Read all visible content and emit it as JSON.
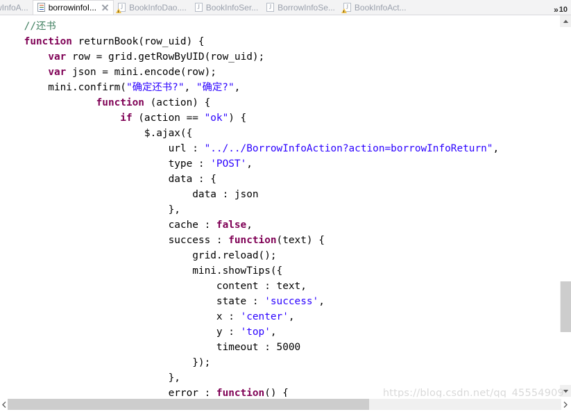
{
  "tabbar": {
    "tabs": [
      {
        "label": "wInfoA...",
        "icon": "javascript-file-icon",
        "state": "partial",
        "active": false,
        "closable": false
      },
      {
        "label": "borrowinfoI...",
        "icon": "javascript-file-icon",
        "state": "normal",
        "active": true,
        "closable": true
      },
      {
        "label": "BookInfoDao....",
        "icon": "java-file-warning-icon",
        "state": "normal",
        "active": false,
        "closable": false
      },
      {
        "label": "BookInfoSer...",
        "icon": "java-file-icon",
        "state": "normal",
        "active": false,
        "closable": false
      },
      {
        "label": "BorrowInfoSe...",
        "icon": "java-file-icon",
        "state": "normal",
        "active": false,
        "closable": false
      },
      {
        "label": "BookInfoAct...",
        "icon": "java-file-warning-icon",
        "state": "normal",
        "active": false,
        "closable": false
      }
    ],
    "overflow_chevron": "»",
    "overflow_count": "10"
  },
  "editor": {
    "lines": [
      [
        {
          "t": "    ",
          "c": "plain"
        },
        {
          "t": "//还书",
          "c": "cmt"
        }
      ],
      [
        {
          "t": "    ",
          "c": "plain"
        },
        {
          "t": "function",
          "c": "kw"
        },
        {
          "t": " returnBook(row_uid) {",
          "c": "plain"
        }
      ],
      [
        {
          "t": "        ",
          "c": "plain"
        },
        {
          "t": "var",
          "c": "kw"
        },
        {
          "t": " row = grid.getRowByUID(row_uid);",
          "c": "plain"
        }
      ],
      [
        {
          "t": "        ",
          "c": "plain"
        },
        {
          "t": "var",
          "c": "kw"
        },
        {
          "t": " json = mini.encode(row);",
          "c": "plain"
        }
      ],
      [
        {
          "t": "        mini.confirm(",
          "c": "plain"
        },
        {
          "t": "\"确定还书?\"",
          "c": "str"
        },
        {
          "t": ", ",
          "c": "plain"
        },
        {
          "t": "\"确定?\"",
          "c": "str"
        },
        {
          "t": ",",
          "c": "plain"
        }
      ],
      [
        {
          "t": "                ",
          "c": "plain"
        },
        {
          "t": "function",
          "c": "kw"
        },
        {
          "t": " (action) {",
          "c": "plain"
        }
      ],
      [
        {
          "t": "                    ",
          "c": "plain"
        },
        {
          "t": "if",
          "c": "kw"
        },
        {
          "t": " (action == ",
          "c": "plain"
        },
        {
          "t": "\"ok\"",
          "c": "str"
        },
        {
          "t": ") {",
          "c": "plain"
        }
      ],
      [
        {
          "t": "                        $.ajax({",
          "c": "plain"
        }
      ],
      [
        {
          "t": "                            url : ",
          "c": "plain"
        },
        {
          "t": "\"../../BorrowInfoAction?action=borrowInfoReturn\"",
          "c": "str"
        },
        {
          "t": ",",
          "c": "plain"
        }
      ],
      [
        {
          "t": "                            type : ",
          "c": "plain"
        },
        {
          "t": "'POST'",
          "c": "str"
        },
        {
          "t": ",",
          "c": "plain"
        }
      ],
      [
        {
          "t": "                            data : {",
          "c": "plain"
        }
      ],
      [
        {
          "t": "                                data : json",
          "c": "plain"
        }
      ],
      [
        {
          "t": "                            },",
          "c": "plain"
        }
      ],
      [
        {
          "t": "                            cache : ",
          "c": "plain"
        },
        {
          "t": "false",
          "c": "kw"
        },
        {
          "t": ",",
          "c": "plain"
        }
      ],
      [
        {
          "t": "                            success : ",
          "c": "plain"
        },
        {
          "t": "function",
          "c": "kw"
        },
        {
          "t": "(text) {",
          "c": "plain"
        }
      ],
      [
        {
          "t": "                                grid.reload();",
          "c": "plain"
        }
      ],
      [
        {
          "t": "                                mini.showTips({",
          "c": "plain"
        }
      ],
      [
        {
          "t": "                                    content : text,",
          "c": "plain"
        }
      ],
      [
        {
          "t": "                                    state : ",
          "c": "plain"
        },
        {
          "t": "'success'",
          "c": "str"
        },
        {
          "t": ",",
          "c": "plain"
        }
      ],
      [
        {
          "t": "                                    x : ",
          "c": "plain"
        },
        {
          "t": "'center'",
          "c": "str"
        },
        {
          "t": ",",
          "c": "plain"
        }
      ],
      [
        {
          "t": "                                    y : ",
          "c": "plain"
        },
        {
          "t": "'top'",
          "c": "str"
        },
        {
          "t": ",",
          "c": "plain"
        }
      ],
      [
        {
          "t": "                                    timeout : 5000",
          "c": "plain"
        }
      ],
      [
        {
          "t": "                                });",
          "c": "plain"
        }
      ],
      [
        {
          "t": "                            },",
          "c": "plain"
        }
      ],
      [
        {
          "t": "                            error : ",
          "c": "plain"
        },
        {
          "t": "function",
          "c": "kw"
        },
        {
          "t": "() {",
          "c": "plain"
        }
      ],
      [
        {
          "t": "                            }",
          "c": "plain"
        }
      ]
    ]
  },
  "scrollbars": {
    "vertical": {
      "up_glyph": "▲",
      "down_glyph": "▼"
    },
    "horizontal": {
      "left_glyph": "❮",
      "right_glyph": "❯"
    }
  },
  "watermark": {
    "text": "https://blog.csdn.net/qq_45554909"
  },
  "colors": {
    "keyword": "#7f0055",
    "string": "#2a00ff",
    "comment": "#3f7f5f",
    "plain": "#000000",
    "tab_active_bg": "#ffffff",
    "tabbar_bg": "#f3f3f4",
    "scroll_thumb": "#cdcdcd"
  }
}
